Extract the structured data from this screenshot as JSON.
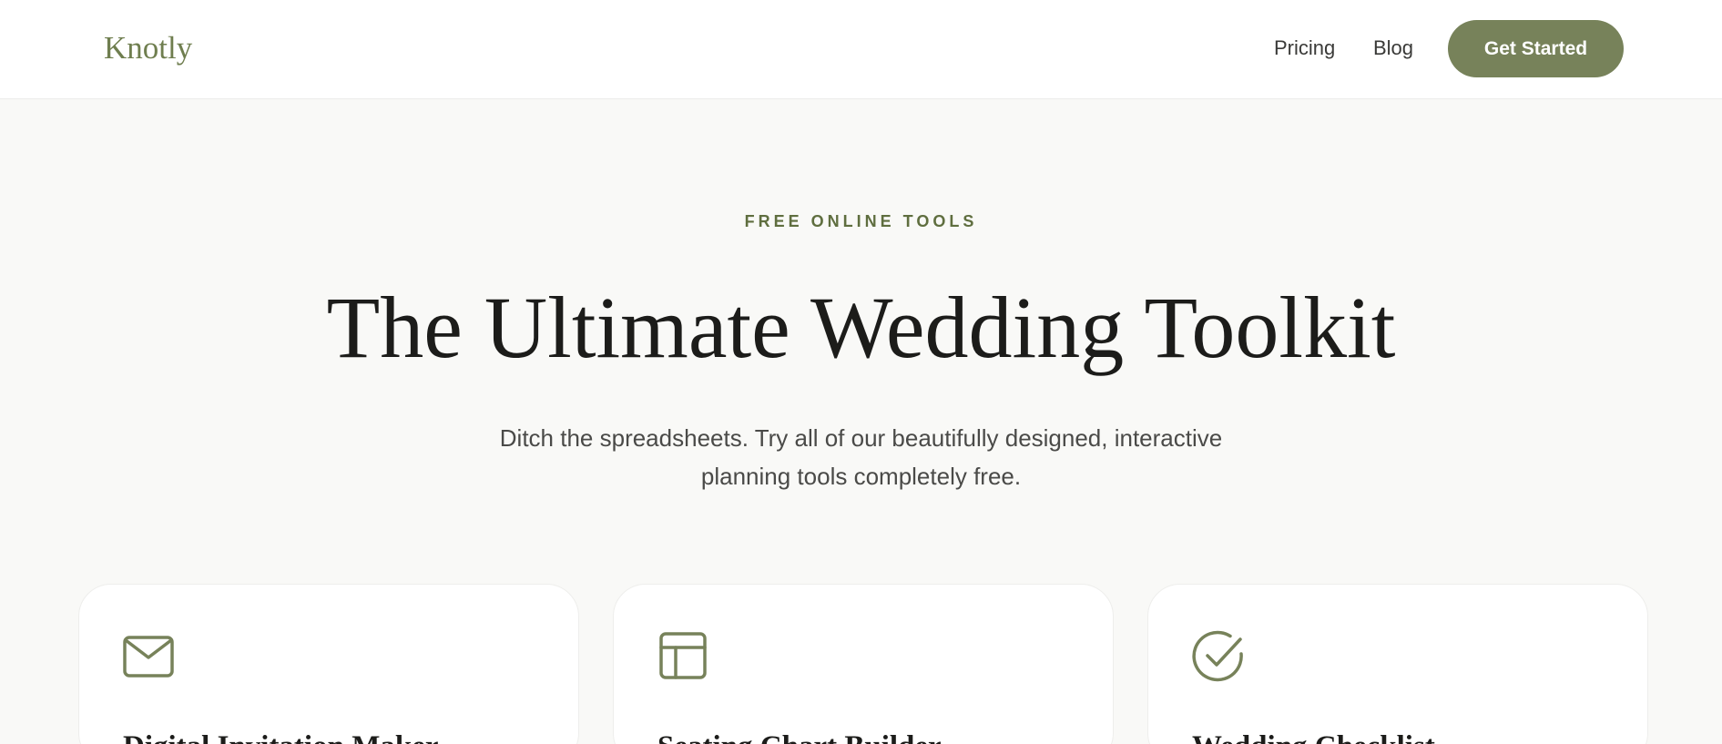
{
  "header": {
    "logo": "Knotly",
    "nav": [
      {
        "label": "Pricing"
      },
      {
        "label": "Blog"
      }
    ],
    "cta_label": "Get Started"
  },
  "hero": {
    "eyebrow": "FREE ONLINE TOOLS",
    "title": "The Ultimate Wedding Toolkit",
    "subtitle_line1": "Ditch the spreadsheets. Try all of our beautifully designed, interactive",
    "subtitle_line2": "planning tools completely free."
  },
  "cards": [
    {
      "icon": "envelope-icon",
      "title": "Digital Invitation Maker"
    },
    {
      "icon": "layout-icon",
      "title": "Seating Chart Builder"
    },
    {
      "icon": "check-circle-icon",
      "title": "Wedding Checklist"
    }
  ],
  "colors": {
    "accent": "#77825a",
    "accent_dark": "#5f6e3f",
    "background": "#f9f9f7"
  }
}
